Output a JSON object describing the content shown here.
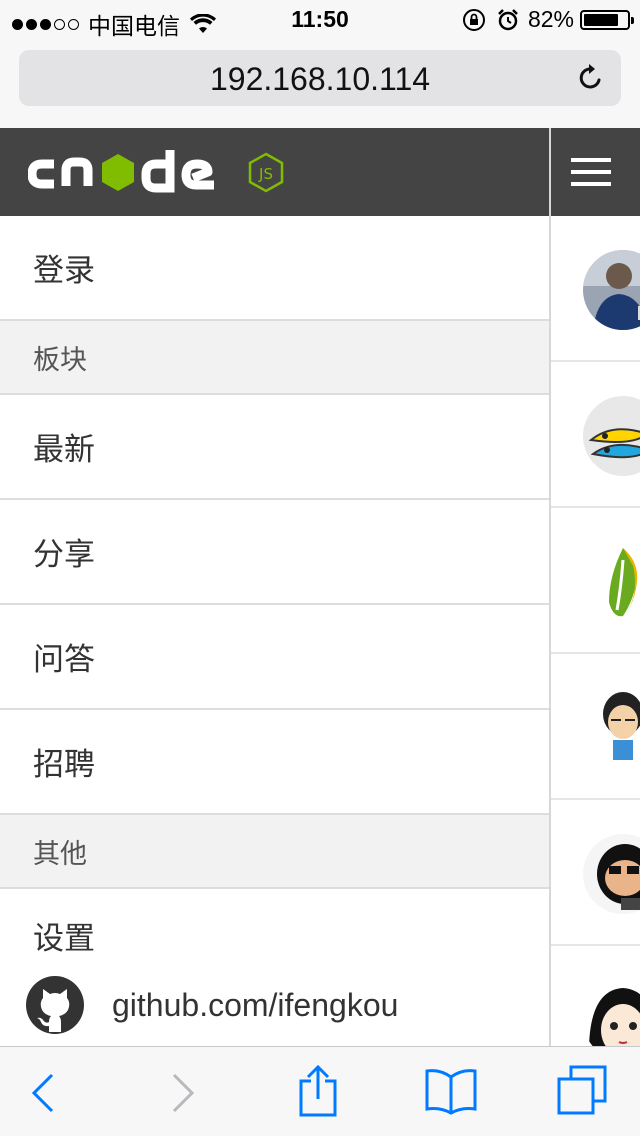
{
  "status_bar": {
    "carrier": "中国电信",
    "time": "11:50",
    "battery_percent": "82%",
    "battery_level": 0.82,
    "signal_strength": 3,
    "signal_max": 5
  },
  "browser": {
    "address": "192.168.10.114"
  },
  "menu": {
    "items": [
      {
        "kind": "item",
        "label": "登录"
      },
      {
        "kind": "header",
        "label": "板块"
      },
      {
        "kind": "item",
        "label": "最新"
      },
      {
        "kind": "item",
        "label": "分享"
      },
      {
        "kind": "item",
        "label": "问答"
      },
      {
        "kind": "item",
        "label": "招聘"
      },
      {
        "kind": "header",
        "label": "其他"
      },
      {
        "kind": "item",
        "label": "设置"
      }
    ],
    "github_link": "github.com/ifengkou"
  },
  "colors": {
    "header_bg": "#444444",
    "node_green": "#80bd01",
    "ios_blue": "#007aff"
  },
  "icons": {
    "reload": "reload-icon",
    "menu": "hamburger-icon",
    "github": "github-icon",
    "back": "back-chevron-icon",
    "forward": "forward-chevron-icon",
    "share": "share-icon",
    "bookmarks": "bookmarks-icon",
    "tabs": "tabs-icon"
  }
}
